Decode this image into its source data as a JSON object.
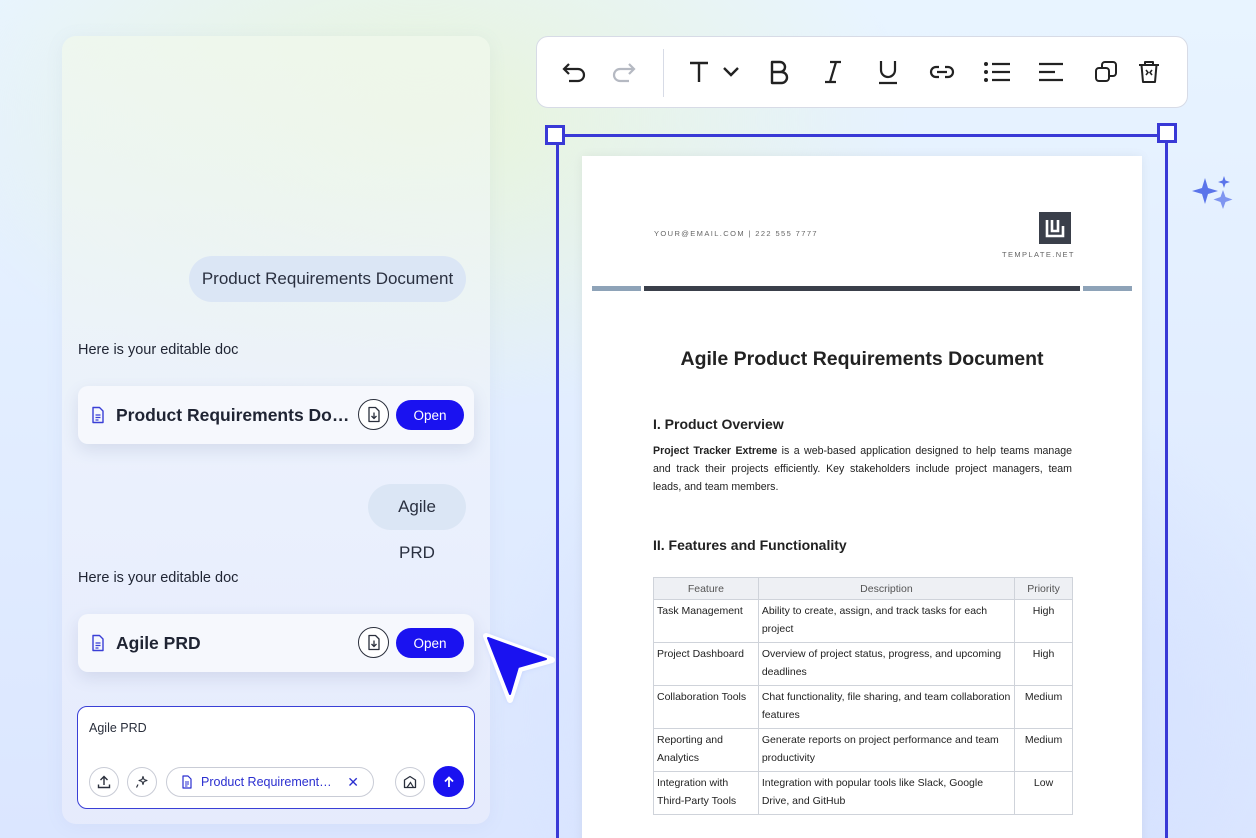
{
  "chat": {
    "messages": [
      {
        "role": "user",
        "text": "Product Requirements Document"
      },
      {
        "role": "assistant",
        "text": "Here is your editable doc"
      },
      {
        "role": "user",
        "text": "Agile PRD"
      },
      {
        "role": "assistant",
        "text": "Here is your editable doc"
      }
    ],
    "cards": [
      {
        "title": "Product Requirements Document",
        "open_label": "Open",
        "icon": "file-icon",
        "download_icon": "download-icon"
      },
      {
        "title": "Agile PRD",
        "open_label": "Open",
        "icon": "file-icon",
        "download_icon": "download-icon"
      }
    ],
    "composer": {
      "value": "Agile PRD",
      "attachment": "Product Requirements Document",
      "upload_icon": "upload-icon",
      "magic_icon": "sparkle-icon",
      "template_icon": "template-icon",
      "send_icon": "arrow-up-icon"
    }
  },
  "toolbar": {
    "tools": [
      "undo-icon",
      "redo-icon",
      "text-style-icon",
      "bold-icon",
      "italic-icon",
      "underline-icon",
      "link-icon",
      "bullet-list-icon",
      "align-left-icon",
      "duplicate-icon",
      "delete-icon"
    ]
  },
  "document": {
    "contact": "YOUR@EMAIL.COM | 222 555 7777",
    "logo_text": "TEMPLATE.NET",
    "title": "Agile Product Requirements Document",
    "section1": {
      "heading": "I. Product Overview",
      "bold_lead": "Project Tracker Extreme",
      "body": " is a web-based application designed to help teams manage and track their projects efficiently. Key stakeholders include project managers, team leads, and team members."
    },
    "section2": {
      "heading": "II. Features and Functionality",
      "columns": [
        "Feature",
        "Description",
        "Priority"
      ],
      "rows": [
        {
          "feature": "Task Management",
          "description": "Ability to create, assign, and track tasks for each project",
          "priority": "High"
        },
        {
          "feature": "Project Dashboard",
          "description": "Overview of project status, progress, and upcoming deadlines",
          "priority": "High"
        },
        {
          "feature": "Collaboration Tools",
          "description": "Chat functionality, file sharing, and team collaboration features",
          "priority": "Medium"
        },
        {
          "feature": "Reporting and Analytics",
          "description": "Generate reports on project performance and team productivity",
          "priority": "Medium"
        },
        {
          "feature": "Integration with Third-Party Tools",
          "description": "Integration with popular tools like Slack, Google Drive, and GitHub",
          "priority": "Low"
        }
      ]
    }
  },
  "colors": {
    "accent": "#1a12f0",
    "selection": "#3939d6",
    "bubble": "#dbe6f5"
  }
}
